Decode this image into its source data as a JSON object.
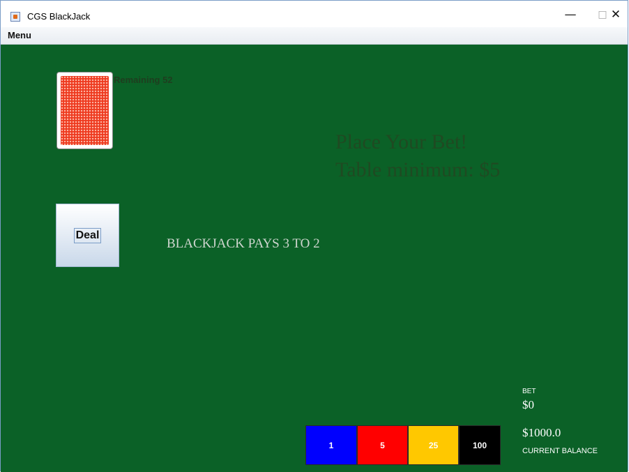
{
  "window": {
    "title": "CGS BlackJack",
    "controls": {
      "minimize": "—",
      "maximize": "□",
      "close": "✕"
    }
  },
  "menubar": {
    "items": [
      "Menu"
    ]
  },
  "deck": {
    "remaining_label": "Remaining 52",
    "back_color": "#ee3a1f"
  },
  "message": {
    "line1": "Place Your Bet!",
    "line2": "Table minimum: $5"
  },
  "deal_button": {
    "label": "Deal"
  },
  "table_text": "BLACKJACK PAYS 3 TO 2",
  "bet": {
    "label": "BET",
    "value": "$0"
  },
  "balance": {
    "value": "$1000.0",
    "label": "CURRENT BALANCE"
  },
  "chips": [
    {
      "label": "1",
      "color": "#0000fe"
    },
    {
      "label": "5",
      "color": "#ff0000"
    },
    {
      "label": "25",
      "color": "#ffc800"
    },
    {
      "label": "100",
      "color": "#000000"
    }
  ],
  "colors": {
    "felt": "#0b6127"
  }
}
